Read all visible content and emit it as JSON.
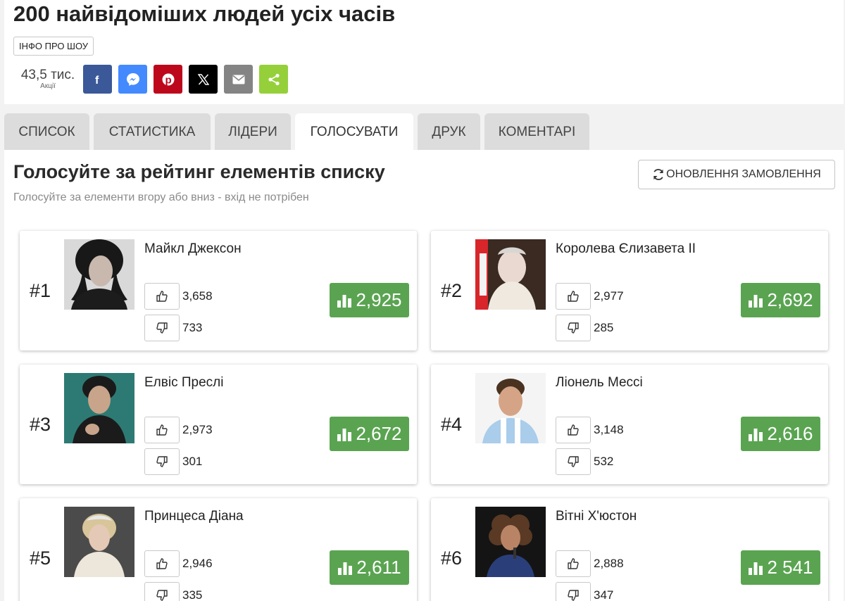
{
  "page": {
    "title": "200 найвідоміших людей усіх часів",
    "info_button": "ІНФО ПРО ШОУ"
  },
  "shares": {
    "count": "43,5 тис.",
    "label": "Акції",
    "buttons": [
      {
        "name": "facebook",
        "color": "#3b5998"
      },
      {
        "name": "messenger",
        "color": "#448aff"
      },
      {
        "name": "pinterest",
        "color": "#bd081c"
      },
      {
        "name": "x",
        "color": "#000000"
      },
      {
        "name": "email",
        "color": "#848484"
      },
      {
        "name": "share",
        "color": "#95d03a"
      }
    ]
  },
  "tabs": [
    {
      "label": "СПИСОК",
      "active": false
    },
    {
      "label": "СТАТИСТИКА",
      "active": false
    },
    {
      "label": "ЛІДЕРИ",
      "active": false
    },
    {
      "label": "ГОЛОСУВАТИ",
      "active": true
    },
    {
      "label": "ДРУК",
      "active": false
    },
    {
      "label": "КОМЕНТАРІ",
      "active": false
    }
  ],
  "vote_panel": {
    "title": "Голосуйте за рейтинг елементів списку",
    "subtitle": "Голосуйте за елементи вгору або вниз - вхід не потрібен",
    "refresh_button": "ОНОВЛЕННЯ ЗАМОВЛЕННЯ",
    "score_color": "#5aa451"
  },
  "items": [
    {
      "rank": "#1",
      "name": "Майкл Джексон",
      "up": "3,658",
      "down": "733",
      "score": "2,925"
    },
    {
      "rank": "#2",
      "name": "Королева Єлизавета II",
      "up": "2,977",
      "down": "285",
      "score": "2,692"
    },
    {
      "rank": "#3",
      "name": "Елвіс Преслі",
      "up": "2,973",
      "down": "301",
      "score": "2,672"
    },
    {
      "rank": "#4",
      "name": "Ліонель Мессі",
      "up": "3,148",
      "down": "532",
      "score": "2,616"
    },
    {
      "rank": "#5",
      "name": "Принцеса Діана",
      "up": "2,946",
      "down": "335",
      "score": "2,611"
    },
    {
      "rank": "#6",
      "name": "Вітні Х'юстон",
      "up": "2,888",
      "down": "347",
      "score": "2 541"
    }
  ]
}
